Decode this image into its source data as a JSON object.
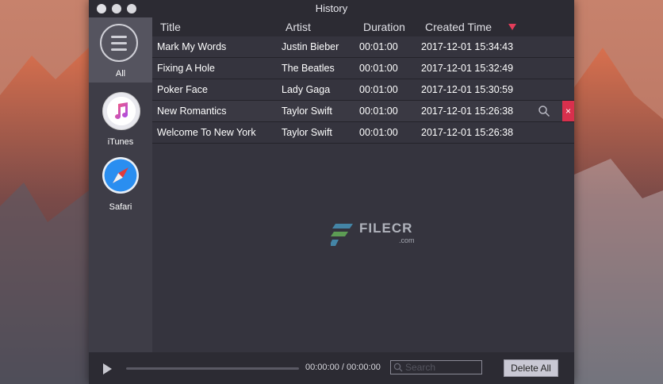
{
  "window": {
    "title": "History"
  },
  "sidebar": {
    "items": [
      {
        "label": "All",
        "icon": "menu-list-icon",
        "active": true
      },
      {
        "label": "iTunes",
        "icon": "itunes-icon",
        "active": false
      },
      {
        "label": "Safari",
        "icon": "safari-compass-icon",
        "active": false
      }
    ]
  },
  "table": {
    "columns": [
      "Title",
      "Artist",
      "Duration",
      "Created Time"
    ],
    "sort": {
      "column": "Created Time",
      "direction": "descending",
      "color": "#e43d5a"
    },
    "rows": [
      {
        "title": "Mark My Words",
        "artist": "Justin Bieber",
        "duration": "00:01:00",
        "created": "2017-12-01 15:34:43"
      },
      {
        "title": "Fixing A Hole",
        "artist": "The Beatles",
        "duration": "00:01:00",
        "created": "2017-12-01 15:32:49"
      },
      {
        "title": "Poker Face",
        "artist": "Lady Gaga",
        "duration": "00:01:00",
        "created": "2017-12-01 15:30:59"
      },
      {
        "title": "New Romantics",
        "artist": "Taylor Swift",
        "duration": "00:01:00",
        "created": "2017-12-01 15:26:38"
      },
      {
        "title": "Welcome To New York",
        "artist": "Taylor Swift",
        "duration": "00:01:00",
        "created": "2017-12-01 15:26:38"
      }
    ],
    "row_actions": {
      "delete_label": "×",
      "delete_color": "#d9304d"
    }
  },
  "watermark": {
    "text": "FILECR",
    "sub": ".com"
  },
  "player": {
    "time": "00:00:00 / 00:00:00",
    "progress": 0
  },
  "search": {
    "placeholder": "Search"
  },
  "actions": {
    "delete_all": "Delete All"
  },
  "colors": {
    "window_bg": "#35343e",
    "sidebar_bg": "#3e3d47",
    "accent": "#e43d5a"
  }
}
